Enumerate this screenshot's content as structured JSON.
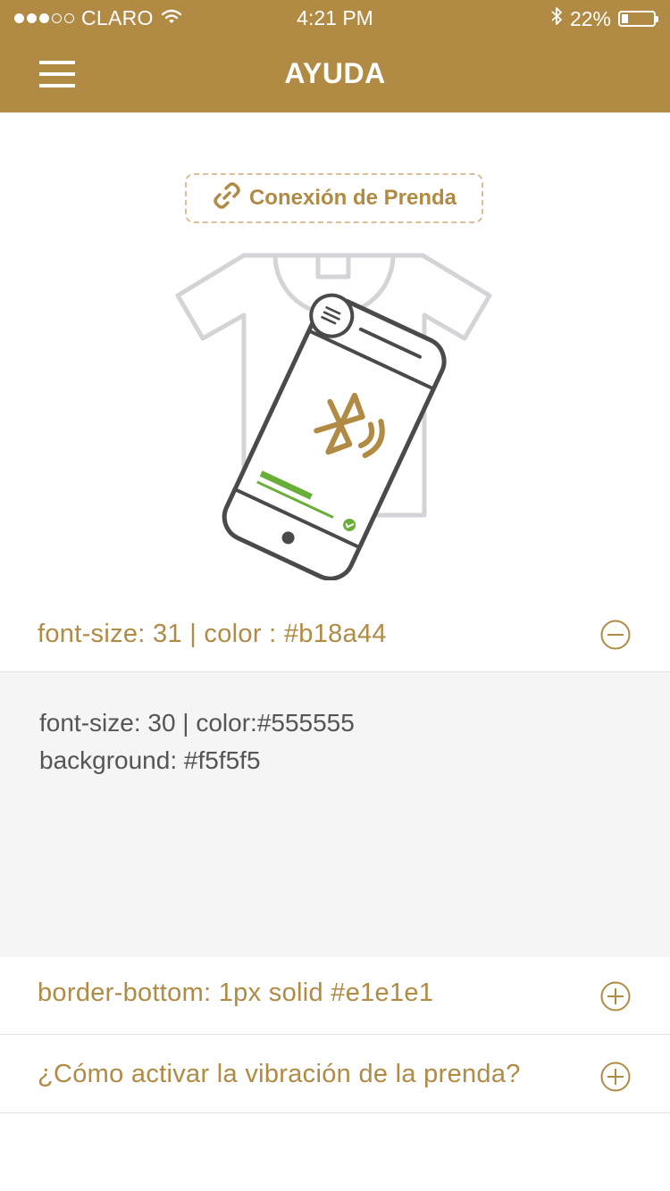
{
  "status_bar": {
    "carrier": "CLARO",
    "time": "4:21 PM",
    "battery": "22%",
    "battery_level": 0.22
  },
  "header": {
    "title": "AYUDA",
    "menu_icon": "hamburger-menu-icon"
  },
  "connection_pill": {
    "label": "Conexión de Prenda",
    "icon": "link-icon"
  },
  "faq": [
    {
      "title": "font-size: 31 | color : #b18a44",
      "expanded": true,
      "icon": "minus-circle-icon",
      "body_lines": [
        "font-size: 30 | color:#555555",
        "background: #f5f5f5"
      ]
    },
    {
      "title": "border-bottom: 1px solid #e1e1e1",
      "expanded": false,
      "icon": "plus-circle-icon"
    },
    {
      "title": "¿Cómo activar la  vibración de la prenda?",
      "expanded": false,
      "icon": "plus-circle-icon"
    }
  ],
  "colors": {
    "accent": "#b18a44",
    "body_text": "#555555",
    "panel_bg": "#f5f5f5",
    "divider": "#e1e1e1",
    "success": "#6aae3a",
    "illustration_gray": "#d3d3d8",
    "phone_outline": "#4a4a4a"
  }
}
